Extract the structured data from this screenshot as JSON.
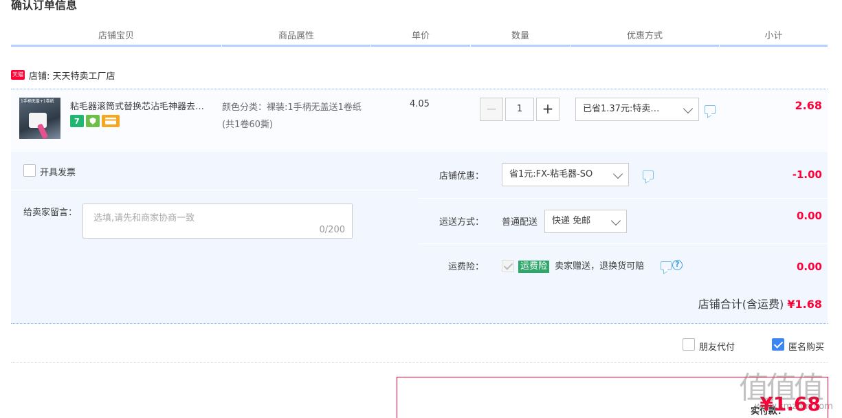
{
  "page_title": "确认订单信息",
  "columns": [
    "店铺宝贝",
    "商品属性",
    "单价",
    "数量",
    "优惠方式",
    "小计"
  ],
  "shop": {
    "badge": "天猫",
    "name": "店铺: 天天特卖工厂店"
  },
  "item": {
    "thumb_text": "1手柄无盖+1卷纸",
    "title": "粘毛器滚筒式替换芯沾毛神器去…",
    "icon_seven": "7",
    "attr": "颜色分类：裸装:1手柄无盖送1卷纸(共1卷60撕)",
    "unit_price": "4.05",
    "qty_minus": "−",
    "qty_value": "1",
    "qty_plus": "+",
    "promo": "已省1.37元:特卖…",
    "subtotal": "2.68"
  },
  "options": {
    "invoice_label": "开具发票",
    "message_label": "给卖家留言：",
    "message_placeholder": "选填,请先和商家协商一致",
    "message_count": "0/200",
    "shop_discount_label": "店铺优惠：",
    "shop_discount_value": "省1元:FX-粘毛器-SO",
    "shop_discount_amount": "-1.00",
    "shipping_label": "运送方式：",
    "shipping_type": "普通配送",
    "shipping_value": "快递 免邮",
    "shipping_amount": "0.00",
    "insurance_label": "运费险：",
    "insurance_tag": "运费险",
    "insurance_text": "卖家赠送，退换货可赔",
    "insurance_amount": "0.00",
    "shop_total_label": "店铺合计(含运费)",
    "shop_total_amount": "¥1.68"
  },
  "extras": {
    "friend_pay": "朋友代付",
    "anonymous": "匿名购买"
  },
  "payment": {
    "label": "实付款：",
    "amount": "¥1.68"
  },
  "watermark": {
    "logo": "值值值",
    "url": "www.smzdm.com"
  },
  "colors": {
    "accent_red": "#ff0036",
    "header_line": "#b2d1ff",
    "panel_bg": "#f2f7ff",
    "checkbox_blue": "#3a86f5"
  }
}
